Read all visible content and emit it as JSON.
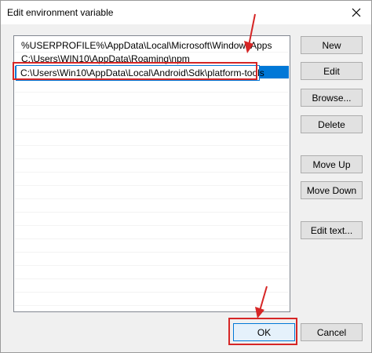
{
  "window": {
    "title": "Edit environment variable"
  },
  "list": {
    "items": [
      "%USERPROFILE%\\AppData\\Local\\Microsoft\\WindowsApps",
      "C:\\Users\\WIN10\\AppData\\Roaming\\npm"
    ],
    "editing_value": "C:\\Users\\Win10\\AppData\\Local\\Android\\Sdk\\platform-tools"
  },
  "buttons": {
    "new": "New",
    "edit": "Edit",
    "browse": "Browse...",
    "delete": "Delete",
    "move_up": "Move Up",
    "move_down": "Move Down",
    "edit_text": "Edit text...",
    "ok": "OK",
    "cancel": "Cancel"
  },
  "colors": {
    "selection": "#0078d7",
    "annotation": "#d62626"
  }
}
